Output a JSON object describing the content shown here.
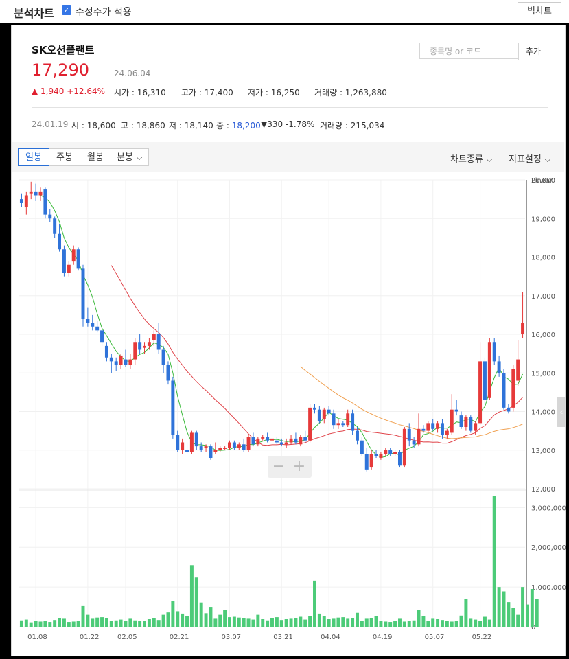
{
  "header": {
    "title": "분석차트",
    "adjusted_label": "수정주가 적용",
    "big_chart_label": "빅차트"
  },
  "stock": {
    "name": "SK오션플랜트",
    "price": "17,290",
    "date": "24.06.04",
    "change": "1,940",
    "change_pct": "+12.64%",
    "open_label": "시가",
    "open": "16,310",
    "high_label": "고가",
    "high": "17,400",
    "low_label": "저가",
    "low": "16,250",
    "volume_label": "거래량",
    "volume": "1,263,880"
  },
  "search": {
    "placeholder": "종목명 or 코드",
    "add_label": "추가"
  },
  "hover": {
    "date": "24.01.19",
    "open_label": "시",
    "open": "18,600",
    "high_label": "고",
    "high": "18,860",
    "low_label": "저",
    "low": "18,140",
    "close_label": "종",
    "close": "18,200",
    "change": "330",
    "change_pct": "-1.78%",
    "volume_label": "거래량",
    "volume": "215,034"
  },
  "tabs": [
    {
      "label": "일봉"
    },
    {
      "label": "주봉"
    },
    {
      "label": "월봉"
    },
    {
      "label": "분봉"
    }
  ],
  "menus": {
    "chart_type": "차트종류",
    "indicators": "지표설정"
  },
  "zoom": {
    "minus": "−",
    "plus": "+"
  },
  "colors": {
    "up": "#e63a3a",
    "down": "#2f73d9",
    "volume": "#4ccb78",
    "ma5": "#3cba3c",
    "ma20": "#e0444a",
    "ma60": "#f0a050",
    "ma120": "#b36ae0"
  },
  "chart_data": {
    "type": "candlestick",
    "scale_label": "Linear",
    "price_ylim": [
      12000,
      20000
    ],
    "price_ticks": [
      "20,000",
      "19,000",
      "18,000",
      "17,000",
      "16,000",
      "15,000",
      "14,000",
      "13,000",
      "12,000"
    ],
    "volume_ylim": [
      0,
      3000000
    ],
    "volume_ticks": [
      "3,000,000",
      "2,000,000",
      "1,000,000",
      "0"
    ],
    "x_labels": [
      "01.08",
      "01.22",
      "02.05",
      "02.21",
      "03.07",
      "03.21",
      "04.04",
      "04.19",
      "05.07",
      "05.22"
    ],
    "candles": [
      {
        "o": 19500,
        "h": 19650,
        "l": 19300,
        "c": 19400
      },
      {
        "o": 19300,
        "h": 19700,
        "l": 19100,
        "c": 19600
      },
      {
        "o": 19650,
        "h": 19950,
        "l": 19500,
        "c": 19700
      },
      {
        "o": 19700,
        "h": 19900,
        "l": 19450,
        "c": 19600
      },
      {
        "o": 19600,
        "h": 19800,
        "l": 19450,
        "c": 19700
      },
      {
        "o": 19750,
        "h": 19800,
        "l": 19000,
        "c": 19100
      },
      {
        "o": 19100,
        "h": 19250,
        "l": 18900,
        "c": 19000
      },
      {
        "o": 19000,
        "h": 19050,
        "l": 18500,
        "c": 18600
      },
      {
        "o": 18600,
        "h": 18860,
        "l": 18140,
        "c": 18200
      },
      {
        "o": 18200,
        "h": 18300,
        "l": 17500,
        "c": 17600
      },
      {
        "o": 17600,
        "h": 17900,
        "l": 17500,
        "c": 17800
      },
      {
        "o": 17900,
        "h": 18300,
        "l": 17800,
        "c": 18200
      },
      {
        "o": 18200,
        "h": 18250,
        "l": 17650,
        "c": 17700
      },
      {
        "o": 17700,
        "h": 17800,
        "l": 16200,
        "c": 16400
      },
      {
        "o": 16400,
        "h": 16700,
        "l": 16200,
        "c": 16300
      },
      {
        "o": 16300,
        "h": 16500,
        "l": 16100,
        "c": 16200
      },
      {
        "o": 16200,
        "h": 16350,
        "l": 16050,
        "c": 16100
      },
      {
        "o": 16100,
        "h": 16150,
        "l": 15700,
        "c": 15800
      },
      {
        "o": 15700,
        "h": 15800,
        "l": 15300,
        "c": 15400
      },
      {
        "o": 15400,
        "h": 15500,
        "l": 15000,
        "c": 15300
      },
      {
        "o": 15300,
        "h": 15400,
        "l": 15050,
        "c": 15200
      },
      {
        "o": 15200,
        "h": 15500,
        "l": 15100,
        "c": 15450
      },
      {
        "o": 15350,
        "h": 15600,
        "l": 15150,
        "c": 15200
      },
      {
        "o": 15200,
        "h": 15500,
        "l": 15100,
        "c": 15350
      },
      {
        "o": 15350,
        "h": 15900,
        "l": 15200,
        "c": 15800
      },
      {
        "o": 15800,
        "h": 16000,
        "l": 15500,
        "c": 15600
      },
      {
        "o": 15650,
        "h": 15800,
        "l": 15500,
        "c": 15700
      },
      {
        "o": 15700,
        "h": 15900,
        "l": 15600,
        "c": 15800
      },
      {
        "o": 15850,
        "h": 16100,
        "l": 15700,
        "c": 16000
      },
      {
        "o": 16000,
        "h": 16300,
        "l": 15500,
        "c": 15600
      },
      {
        "o": 15600,
        "h": 15700,
        "l": 15000,
        "c": 15200
      },
      {
        "o": 15200,
        "h": 15300,
        "l": 14700,
        "c": 14800
      },
      {
        "o": 14800,
        "h": 14900,
        "l": 13300,
        "c": 13400
      },
      {
        "o": 13400,
        "h": 13500,
        "l": 12950,
        "c": 13000
      },
      {
        "o": 13000,
        "h": 13300,
        "l": 12900,
        "c": 13200
      },
      {
        "o": 13000,
        "h": 13200,
        "l": 12900,
        "c": 12950
      },
      {
        "o": 12950,
        "h": 13500,
        "l": 12900,
        "c": 13450
      },
      {
        "o": 13450,
        "h": 13500,
        "l": 13000,
        "c": 13100
      },
      {
        "o": 13100,
        "h": 13200,
        "l": 12950,
        "c": 13000
      },
      {
        "o": 13050,
        "h": 13150,
        "l": 12950,
        "c": 13100
      },
      {
        "o": 13100,
        "h": 13150,
        "l": 12750,
        "c": 12800
      },
      {
        "o": 12950,
        "h": 13200,
        "l": 12900,
        "c": 13000
      },
      {
        "o": 13000,
        "h": 13100,
        "l": 12950,
        "c": 13050
      },
      {
        "o": 13050,
        "h": 13100,
        "l": 13000,
        "c": 13050
      },
      {
        "o": 13050,
        "h": 13250,
        "l": 13000,
        "c": 13200
      },
      {
        "o": 13200,
        "h": 13250,
        "l": 13000,
        "c": 13050
      },
      {
        "o": 13050,
        "h": 13200,
        "l": 13000,
        "c": 13150
      },
      {
        "o": 13150,
        "h": 13300,
        "l": 12950,
        "c": 13000
      },
      {
        "o": 13000,
        "h": 13400,
        "l": 12950,
        "c": 13350
      },
      {
        "o": 13350,
        "h": 13450,
        "l": 13100,
        "c": 13150
      },
      {
        "o": 13150,
        "h": 13350,
        "l": 13100,
        "c": 13300
      },
      {
        "o": 13300,
        "h": 13400,
        "l": 13250,
        "c": 13350
      },
      {
        "o": 13350,
        "h": 13450,
        "l": 13200,
        "c": 13250
      },
      {
        "o": 13250,
        "h": 13350,
        "l": 13150,
        "c": 13300
      },
      {
        "o": 13250,
        "h": 13350,
        "l": 13150,
        "c": 13200
      },
      {
        "o": 13200,
        "h": 13300,
        "l": 13100,
        "c": 13150
      },
      {
        "o": 13150,
        "h": 13300,
        "l": 13050,
        "c": 13200
      },
      {
        "o": 13200,
        "h": 13400,
        "l": 13150,
        "c": 13300
      },
      {
        "o": 13300,
        "h": 13450,
        "l": 13150,
        "c": 13200
      },
      {
        "o": 13150,
        "h": 13400,
        "l": 13100,
        "c": 13350
      },
      {
        "o": 13350,
        "h": 13500,
        "l": 13200,
        "c": 13250
      },
      {
        "o": 13250,
        "h": 14200,
        "l": 13200,
        "c": 14100
      },
      {
        "o": 14100,
        "h": 14200,
        "l": 13950,
        "c": 14050
      },
      {
        "o": 14050,
        "h": 14150,
        "l": 13700,
        "c": 13750
      },
      {
        "o": 13800,
        "h": 14100,
        "l": 13700,
        "c": 14050
      },
      {
        "o": 14050,
        "h": 14150,
        "l": 13900,
        "c": 13950
      },
      {
        "o": 13950,
        "h": 14050,
        "l": 13550,
        "c": 13650
      },
      {
        "o": 13650,
        "h": 13800,
        "l": 13550,
        "c": 13700
      },
      {
        "o": 13700,
        "h": 13750,
        "l": 13600,
        "c": 13650
      },
      {
        "o": 13650,
        "h": 14050,
        "l": 13600,
        "c": 13950
      },
      {
        "o": 13950,
        "h": 14050,
        "l": 13400,
        "c": 13500
      },
      {
        "o": 13500,
        "h": 13600,
        "l": 13150,
        "c": 13250
      },
      {
        "o": 13250,
        "h": 13350,
        "l": 12850,
        "c": 12900
      },
      {
        "o": 12900,
        "h": 13050,
        "l": 12450,
        "c": 12500
      },
      {
        "o": 12550,
        "h": 13000,
        "l": 12500,
        "c": 12900
      },
      {
        "o": 12900,
        "h": 13000,
        "l": 12800,
        "c": 12850
      },
      {
        "o": 12800,
        "h": 12950,
        "l": 12750,
        "c": 12900
      },
      {
        "o": 12900,
        "h": 13050,
        "l": 12850,
        "c": 13000
      },
      {
        "o": 13000,
        "h": 13050,
        "l": 12850,
        "c": 12900
      },
      {
        "o": 12900,
        "h": 13000,
        "l": 12850,
        "c": 12950
      },
      {
        "o": 12950,
        "h": 13000,
        "l": 12550,
        "c": 12600
      },
      {
        "o": 12600,
        "h": 13600,
        "l": 12550,
        "c": 13550
      },
      {
        "o": 13550,
        "h": 13700,
        "l": 13100,
        "c": 13250
      },
      {
        "o": 13250,
        "h": 13350,
        "l": 13050,
        "c": 13150
      },
      {
        "o": 13150,
        "h": 13950,
        "l": 13100,
        "c": 13550
      },
      {
        "o": 13550,
        "h": 13650,
        "l": 13450,
        "c": 13500
      },
      {
        "o": 13500,
        "h": 13750,
        "l": 13450,
        "c": 13700
      },
      {
        "o": 13700,
        "h": 13800,
        "l": 13500,
        "c": 13550
      },
      {
        "o": 13550,
        "h": 13750,
        "l": 13450,
        "c": 13700
      },
      {
        "o": 13700,
        "h": 13800,
        "l": 13300,
        "c": 13400
      },
      {
        "o": 13400,
        "h": 13550,
        "l": 13300,
        "c": 13500
      },
      {
        "o": 13450,
        "h": 14450,
        "l": 13400,
        "c": 14050
      },
      {
        "o": 14050,
        "h": 14300,
        "l": 13900,
        "c": 14000
      },
      {
        "o": 13900,
        "h": 14000,
        "l": 13550,
        "c": 13600
      },
      {
        "o": 13600,
        "h": 13900,
        "l": 13500,
        "c": 13850
      },
      {
        "o": 13850,
        "h": 13900,
        "l": 13450,
        "c": 13500
      },
      {
        "o": 13500,
        "h": 13750,
        "l": 13400,
        "c": 13700
      },
      {
        "o": 13700,
        "h": 15800,
        "l": 13650,
        "c": 15300
      },
      {
        "o": 15300,
        "h": 15400,
        "l": 14200,
        "c": 14300
      },
      {
        "o": 14350,
        "h": 15900,
        "l": 14300,
        "c": 15800
      },
      {
        "o": 15800,
        "h": 15900,
        "l": 15200,
        "c": 15300
      },
      {
        "o": 15300,
        "h": 15450,
        "l": 14900,
        "c": 15000
      },
      {
        "o": 15000,
        "h": 15100,
        "l": 14050,
        "c": 14100
      },
      {
        "o": 14100,
        "h": 14200,
        "l": 13950,
        "c": 14000
      },
      {
        "o": 14100,
        "h": 15200,
        "l": 14000,
        "c": 15100
      },
      {
        "o": 14800,
        "h": 15850,
        "l": 14650,
        "c": 15350
      },
      {
        "o": 16000,
        "h": 17100,
        "l": 15900,
        "c": 16300
      }
    ],
    "volumes": [
      160000,
      180000,
      110000,
      140000,
      130000,
      150000,
      120000,
      170000,
      215034,
      200000,
      120000,
      130000,
      140000,
      520000,
      300000,
      200000,
      230000,
      240000,
      220000,
      150000,
      160000,
      180000,
      140000,
      200000,
      160000,
      150000,
      140000,
      190000,
      210000,
      170000,
      300000,
      360000,
      650000,
      390000,
      330000,
      270000,
      1550000,
      1240000,
      610000,
      340000,
      500000,
      200000,
      300000,
      420000,
      240000,
      250000,
      230000,
      210000,
      200000,
      180000,
      300000,
      190000,
      160000,
      210000,
      240000,
      170000,
      190000,
      200000,
      220000,
      250000,
      180000,
      270000,
      1160000,
      330000,
      260000,
      190000,
      200000,
      230000,
      240000,
      200000,
      220000,
      350000,
      150000,
      200000,
      210000,
      260000,
      150000,
      130000,
      120000,
      140000,
      200000,
      130000,
      140000,
      160000,
      430000,
      260000,
      150000,
      200000,
      190000,
      170000,
      150000,
      130000,
      140000,
      280000,
      700000,
      200000,
      180000,
      150000,
      250000,
      180000,
      3300000,
      1000000,
      890000,
      620000,
      480000,
      300000,
      1000000,
      560000,
      950000,
      700000
    ]
  }
}
